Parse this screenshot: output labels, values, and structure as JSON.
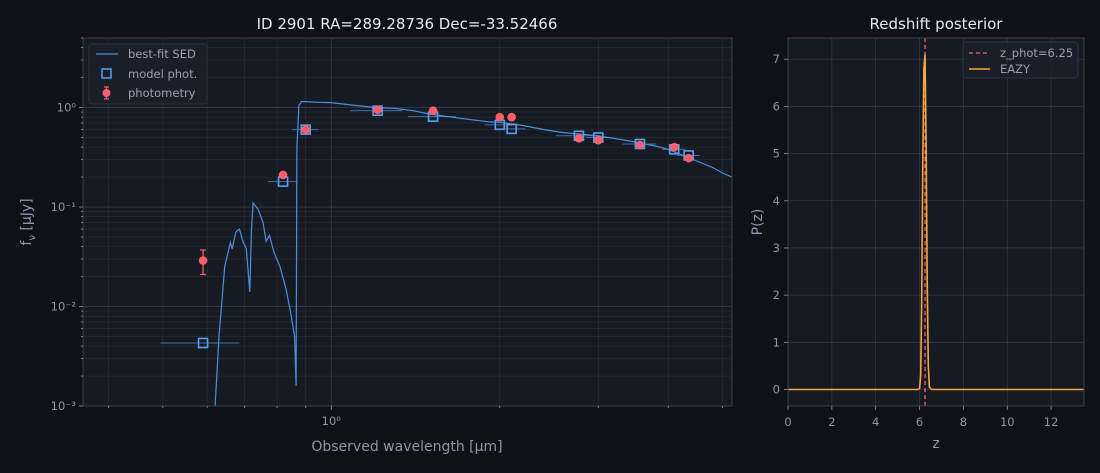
{
  "colors": {
    "figure_bg": "#0f1117",
    "axes_bg": "#161a22",
    "grid": "#3a3f4b",
    "spine": "#3a3f4b",
    "sed": "#4a8fe0",
    "model": "#5aa0f0",
    "phot": "#ff5f6d",
    "eazy": "#f5a742",
    "zline": "#ff5f6d"
  },
  "chart_data": [
    {
      "type": "scatter",
      "title": "ID 2901  RA=289.28736  Dec=-33.52466",
      "xlabel": "Observed wavelength [μm]",
      "ylabel": "f_ν [μJy]",
      "ylabel_main": "f",
      "ylabel_sub": "ν",
      "ylabel_rest": " [μJy]",
      "xscale": "log",
      "yscale": "log",
      "xlim": [
        0.36,
        5.2
      ],
      "ylim": [
        0.001,
        5
      ],
      "x_tick_values": [
        1.0
      ],
      "x_tick_labels": [
        "10⁰"
      ],
      "y_tick_values": [
        0.001,
        0.01,
        0.1,
        1.0
      ],
      "y_tick_labels": [
        "10⁻³",
        "10⁻²",
        "10⁻¹",
        "10⁰"
      ],
      "grid": true,
      "legend": {
        "placement": "top-left",
        "entries": [
          "best-fit SED",
          "model phot.",
          "photometry"
        ]
      },
      "series": [
        {
          "name": "best-fit SED",
          "style": "line",
          "points": [
            [
              0.62,
              0.001
            ],
            [
              0.63,
              0.005
            ],
            [
              0.645,
              0.025
            ],
            [
              0.66,
              0.044
            ],
            [
              0.665,
              0.038
            ],
            [
              0.675,
              0.056
            ],
            [
              0.685,
              0.06
            ],
            [
              0.695,
              0.045
            ],
            [
              0.705,
              0.038
            ],
            [
              0.715,
              0.014
            ],
            [
              0.72,
              0.06
            ],
            [
              0.725,
              0.11
            ],
            [
              0.74,
              0.095
            ],
            [
              0.755,
              0.07
            ],
            [
              0.765,
              0.045
            ],
            [
              0.775,
              0.052
            ],
            [
              0.79,
              0.035
            ],
            [
              0.81,
              0.025
            ],
            [
              0.83,
              0.015
            ],
            [
              0.845,
              0.009
            ],
            [
              0.86,
              0.005
            ],
            [
              0.865,
              0.0016
            ],
            [
              0.868,
              0.4
            ],
            [
              0.875,
              1.05
            ],
            [
              0.885,
              1.15
            ],
            [
              0.95,
              1.13
            ],
            [
              1.0,
              1.12
            ],
            [
              1.1,
              1.05
            ],
            [
              1.2,
              1.0
            ],
            [
              1.3,
              0.98
            ],
            [
              1.4,
              0.93
            ],
            [
              1.5,
              0.86
            ],
            [
              1.7,
              0.78
            ],
            [
              1.9,
              0.72
            ],
            [
              2.0,
              0.71
            ],
            [
              2.2,
              0.66
            ],
            [
              2.4,
              0.6
            ],
            [
              2.6,
              0.56
            ],
            [
              2.8,
              0.54
            ],
            [
              3.0,
              0.52
            ],
            [
              3.2,
              0.49
            ],
            [
              3.5,
              0.45
            ],
            [
              3.8,
              0.41
            ],
            [
              4.0,
              0.38
            ],
            [
              4.2,
              0.34
            ],
            [
              4.5,
              0.29
            ],
            [
              4.8,
              0.25
            ],
            [
              5.0,
              0.22
            ],
            [
              5.2,
              0.2
            ]
          ]
        },
        {
          "name": "model phot.",
          "style": "open-square",
          "x": [
            0.59,
            0.82,
            0.9,
            1.21,
            1.52,
            2.0,
            2.1,
            2.77,
            3.0,
            3.56,
            4.1,
            4.35
          ],
          "y": [
            0.0043,
            0.18,
            0.6,
            0.93,
            0.81,
            0.67,
            0.61,
            0.52,
            0.5,
            0.43,
            0.38,
            0.33
          ],
          "xerr": [
            0.095,
            0.05,
            0.05,
            0.13,
            0.15,
            0.12,
            0.12,
            0.25,
            0.15,
            0.25,
            0.2,
            0.2
          ]
        },
        {
          "name": "photometry",
          "style": "errorbar-point",
          "x": [
            0.59,
            0.82,
            0.9,
            1.21,
            1.52,
            2.0,
            2.1,
            2.77,
            3.0,
            3.56,
            4.1,
            4.35
          ],
          "y": [
            0.029,
            0.21,
            0.6,
            0.95,
            0.93,
            0.8,
            0.8,
            0.49,
            0.47,
            0.42,
            0.4,
            0.31
          ],
          "yerr": [
            [
              0.021,
              0.037
            ],
            null,
            null,
            null,
            null,
            null,
            null,
            null,
            null,
            null,
            null,
            null
          ]
        }
      ]
    },
    {
      "type": "line",
      "title": "Redshift posterior",
      "xlabel": "z",
      "ylabel": "P(z)",
      "xlim": [
        0,
        13.5
      ],
      "ylim": [
        -0.35,
        7.45
      ],
      "x_tick_values": [
        0,
        2,
        4,
        6,
        8,
        10,
        12
      ],
      "x_tick_labels": [
        "0",
        "2",
        "4",
        "6",
        "8",
        "10",
        "12"
      ],
      "y_tick_values": [
        0,
        1,
        2,
        3,
        4,
        5,
        6,
        7
      ],
      "y_tick_labels": [
        "0",
        "1",
        "2",
        "3",
        "4",
        "5",
        "6",
        "7"
      ],
      "grid": true,
      "legend": {
        "placement": "top-right",
        "entries": [
          "z_phot=6.25",
          "EAZY"
        ]
      },
      "series": [
        {
          "name": "z_phot=6.25",
          "style": "dashed-vline",
          "x": 6.25
        },
        {
          "name": "EAZY",
          "style": "line",
          "x": [
            0,
            5.9,
            6.0,
            6.05,
            6.1,
            6.15,
            6.2,
            6.25,
            6.3,
            6.35,
            6.4,
            6.45,
            6.55,
            13.5
          ],
          "y": [
            0,
            0,
            0.02,
            0.3,
            1.9,
            4.8,
            6.8,
            7.1,
            5.3,
            2.3,
            0.5,
            0.05,
            0,
            0
          ]
        }
      ]
    }
  ]
}
